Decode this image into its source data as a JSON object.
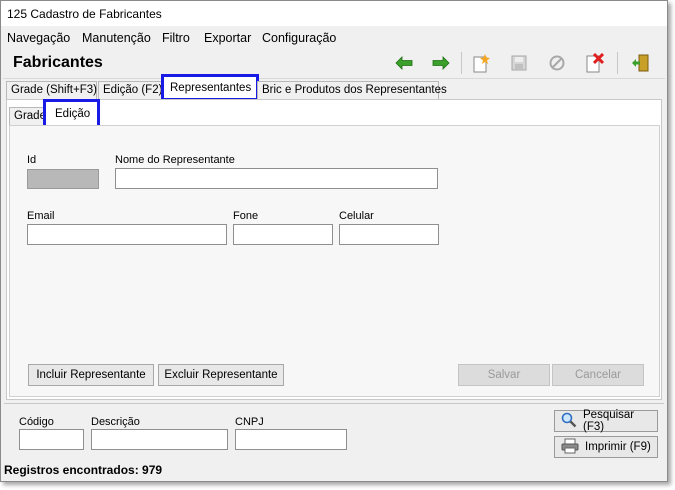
{
  "window": {
    "title": "125 Cadastro de Fabricantes"
  },
  "menu": [
    "Navegação",
    "Manutenção",
    "Filtro",
    "Exportar",
    "Configuração"
  ],
  "heading": "Fabricantes",
  "toolbar_icons": [
    "back-arrow-icon",
    "forward-arrow-icon",
    "new-record-icon",
    "save-disk-icon",
    "cancel-circle-icon",
    "delete-icon",
    "exit-door-icon"
  ],
  "tabs_main": [
    "Grade (Shift+F3)",
    "Edição (F2)",
    "Representantes",
    "Bric e Produtos dos Representantes"
  ],
  "tabs_sub": [
    "Grade",
    "Edição"
  ],
  "form": {
    "id_label": "Id",
    "nome_label": "Nome do Representante",
    "email_label": "Email",
    "fone_label": "Fone",
    "celular_label": "Celular",
    "id_value": "",
    "nome_value": "",
    "email_value": "",
    "fone_value": "",
    "celular_value": ""
  },
  "buttons": {
    "incluir": "Incluir Representante",
    "excluir": "Excluir Representante",
    "salvar": "Salvar",
    "cancelar": "Cancelar"
  },
  "filter": {
    "codigo_label": "Código",
    "descricao_label": "Descrição",
    "cnpj_label": "CNPJ",
    "codigo_value": "",
    "descricao_value": "",
    "cnpj_value": ""
  },
  "actions": {
    "pesquisar": "Pesquisar (F3)",
    "imprimir": "Imprimir (F9)"
  },
  "status": "Registros encontrados: 979"
}
